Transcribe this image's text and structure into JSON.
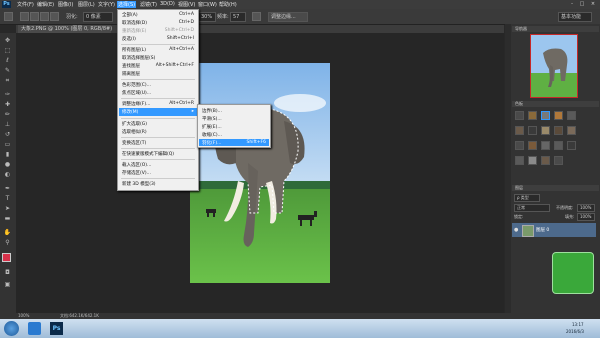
{
  "app": {
    "logo": "Ps"
  },
  "menubar": {
    "items": [
      "文件(F)",
      "编辑(E)",
      "图像(I)",
      "图层(L)",
      "文字(Y)",
      "选择(S)",
      "滤镜(T)",
      "3D(D)",
      "视图(V)",
      "窗口(W)",
      "帮助(H)"
    ]
  },
  "window_controls": [
    "-",
    "□",
    "×"
  ],
  "options": {
    "feather_label": "羽化:",
    "feather_value": "0 像素",
    "zoom_value": "30%",
    "frequency_label": "频率:",
    "frequency_value": "57",
    "refine_button": "调整边缘...",
    "workspace": "基本功能"
  },
  "document": {
    "tab": "大象2.PNG @ 100% (图层 0, RGB/8#)",
    "close": "×"
  },
  "select_menu": {
    "items": [
      {
        "label": "全部(A)",
        "shortcut": "Ctrl+A"
      },
      {
        "label": "取消选择(D)",
        "shortcut": "Ctrl+D"
      },
      {
        "label": "重新选择(E)",
        "shortcut": "Shift+Ctrl+D"
      },
      {
        "label": "反选(I)",
        "shortcut": "Shift+Ctrl+I"
      },
      {
        "label": "所有图层(L)",
        "shortcut": "Alt+Ctrl+A"
      },
      {
        "label": "取消选择图层(S)",
        "shortcut": ""
      },
      {
        "label": "查找图层",
        "shortcut": "Alt+Shift+Ctrl+F"
      },
      {
        "label": "隔离图层",
        "shortcut": ""
      },
      {
        "label": "色彩范围(C)...",
        "shortcut": ""
      },
      {
        "label": "焦点区域(U)...",
        "shortcut": ""
      },
      {
        "label": "调整边缘(F)...",
        "shortcut": "Alt+Ctrl+R"
      },
      {
        "label": "修改(M)",
        "shortcut": "▸"
      },
      {
        "label": "扩大选取(G)",
        "shortcut": ""
      },
      {
        "label": "选取相似(R)",
        "shortcut": ""
      },
      {
        "label": "变换选区(T)",
        "shortcut": ""
      },
      {
        "label": "在快速蒙版模式下编辑(Q)",
        "shortcut": ""
      },
      {
        "label": "载入选区(O)...",
        "shortcut": ""
      },
      {
        "label": "存储选区(V)...",
        "shortcut": ""
      },
      {
        "label": "新建 3D 模型(3)",
        "shortcut": ""
      }
    ]
  },
  "modify_submenu": {
    "items": [
      {
        "label": "边界(B)...",
        "shortcut": ""
      },
      {
        "label": "平滑(S)...",
        "shortcut": ""
      },
      {
        "label": "扩展(E)...",
        "shortcut": ""
      },
      {
        "label": "收缩(C)...",
        "shortcut": ""
      },
      {
        "label": "羽化(F)...",
        "shortcut": "Shift+F6"
      }
    ]
  },
  "panels": {
    "navigator_tab": "导航器",
    "swatches_tab": "色板",
    "layers_tab": "图层",
    "kind_label": "ρ 类型",
    "blend_mode": "正常",
    "opacity_label": "不透明度:",
    "opacity_value": "100%",
    "lock_label": "锁定:",
    "fill_label": "填充:",
    "fill_value": "100%",
    "layer_name": "图层 0"
  },
  "status": {
    "zoom": "100%",
    "doc_size": "文档:642.1K/642.1K"
  },
  "taskbar": {
    "time": "13:17",
    "date": "2016/6/3"
  },
  "colors": {
    "accent": "#3399ff",
    "menu_highlight": "#3399ff",
    "menu_bg": "#f0f0f0"
  }
}
